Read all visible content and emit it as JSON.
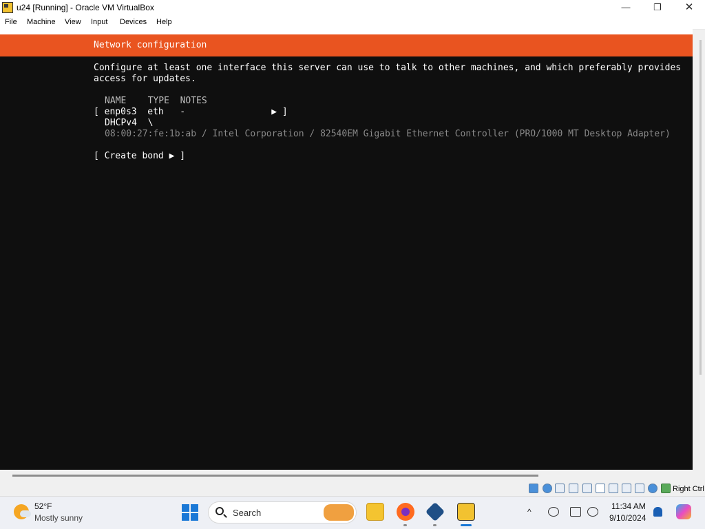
{
  "window": {
    "title": "u24 [Running] - Oracle VM VirtualBox",
    "minimize_glyph": "—",
    "maximize_glyph": "❐",
    "close_glyph": "✕",
    "icon": "virtualbox-vm-icon"
  },
  "menu": {
    "items": [
      {
        "label": "File"
      },
      {
        "label": "Machine"
      },
      {
        "label": "View"
      },
      {
        "label": "Input"
      },
      {
        "label": "Devices"
      },
      {
        "label": "Help"
      }
    ]
  },
  "installer": {
    "header": "Network configuration",
    "description_line1": "Configure at least one interface this server can use to talk to other machines, and which preferably provides",
    "description_line2": "access for updates.",
    "columns": "NAME    TYPE  NOTES",
    "interface_row": "[ enp0s3  eth   -                ▶ ]",
    "dhcp_row": "DHCPv4  \\",
    "mac_row": "08:00:27:fe:1b:ab / Intel Corporation / 82540EM Gigabit Ethernet Controller (PRO/1000 MT Desktop Adapter)",
    "create_bond": "[ Create bond ▶ ]",
    "header_color": "#e95420",
    "background_color": "#0f0f0f"
  },
  "statusbar": {
    "host_key": "Right Ctrl",
    "icons": [
      "hard-disk-icon",
      "optical-drive-icon",
      "audio-icon",
      "network-icon",
      "usb-icon",
      "shared-folders-icon",
      "display-icon",
      "video-capture-icon",
      "cpu-icon",
      "mouse-integration-icon",
      "keyboard-icon"
    ]
  },
  "taskbar": {
    "weather_temp": "52°F",
    "weather_desc": "Mostly sunny",
    "search_placeholder": "Search",
    "time": "11:34 AM",
    "date": "9/10/2024",
    "tray_chevron": "^",
    "apps": [
      "file-explorer-icon",
      "firefox-icon",
      "virtualbox-manager-icon",
      "virtualbox-vm-icon"
    ]
  }
}
